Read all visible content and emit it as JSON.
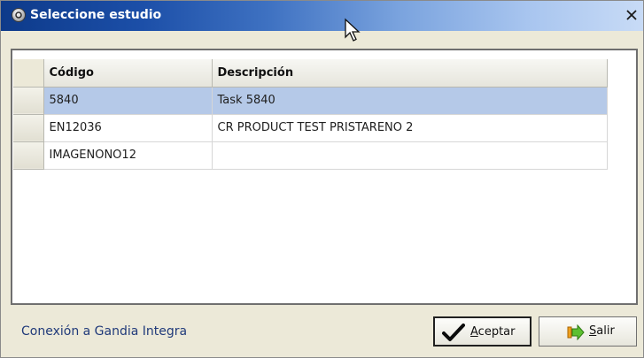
{
  "window": {
    "title": "Seleccione estudio",
    "close_glyph": "×"
  },
  "grid": {
    "columns": [
      "Código",
      "Descripción"
    ],
    "rows": [
      {
        "code": "5840",
        "description": "Task 5840",
        "selected": true
      },
      {
        "code": "EN12036",
        "description": "CR PRODUCT TEST PRISTARENO 2",
        "selected": false
      },
      {
        "code": "IMAGENONO12",
        "description": "",
        "selected": false
      }
    ]
  },
  "status": {
    "text": "Conexión a Gandia Integra"
  },
  "buttons": {
    "accept": {
      "mnemonic": "A",
      "rest": "ceptar",
      "icon": "checkmark-icon"
    },
    "exit": {
      "mnemonic": "S",
      "rest": "alir",
      "icon": "exit-arrow-icon"
    }
  },
  "colors": {
    "selected_row": "#b5c9e8",
    "status_text": "#203a7a",
    "window_bg": "#ece9d8"
  }
}
